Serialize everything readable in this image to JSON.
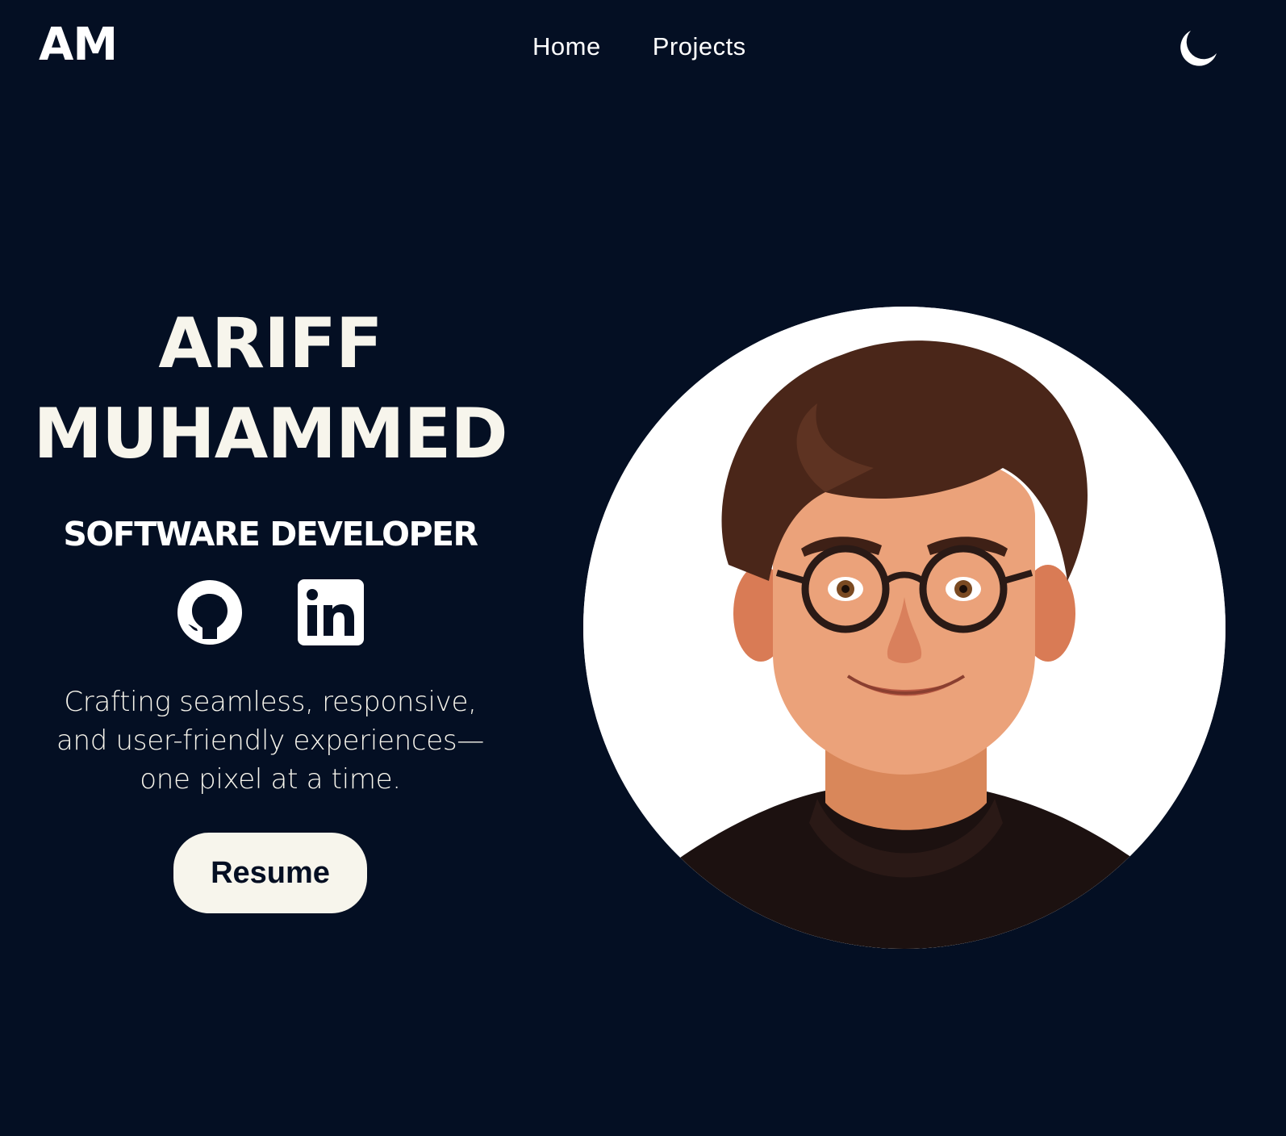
{
  "header": {
    "logo": "AM",
    "nav": [
      {
        "label": "Home"
      },
      {
        "label": "Projects"
      }
    ],
    "theme_toggle_icon": "moon-icon"
  },
  "hero": {
    "name_line1": "ARIFF",
    "name_line2": "MUHAMMED",
    "role": "SOFTWARE DEVELOPER",
    "socials": [
      {
        "icon": "github-icon"
      },
      {
        "icon": "linkedin-icon"
      }
    ],
    "tagline": "Crafting seamless, responsive, and user-friendly experiences—one pixel at a time.",
    "resume_label": "Resume"
  },
  "colors": {
    "background": "#040f23",
    "text": "#f7f5ec",
    "button_bg": "#f7f5ec",
    "button_text": "#040f23"
  }
}
